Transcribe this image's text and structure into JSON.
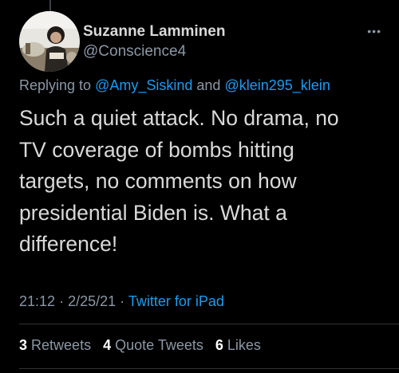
{
  "author": {
    "display_name": "Suzanne Lamminen",
    "handle": "@Conscience4"
  },
  "more_icon": "more-options-icon",
  "reply": {
    "prefix": "Replying to",
    "mention_1": "@Amy_Siskind",
    "connector": "and",
    "mention_2": "@klein295_klein"
  },
  "tweet": {
    "lines": [
      "Such a quiet attack. No drama, no",
      "TV coverage of bombs hitting",
      "targets, no comments on how",
      "presidential Biden is. What a",
      "difference!"
    ]
  },
  "meta": {
    "time": "21:12",
    "separator_1": "·",
    "date": "2/25/21",
    "separator_2": "·",
    "source": "Twitter for iPad"
  },
  "stats": {
    "retweets_count": "3",
    "retweets_label": "Retweets",
    "quotes_count": "4",
    "quotes_label": "Quote Tweets",
    "likes_count": "6",
    "likes_label": "Likes"
  },
  "colors": {
    "background": "#000000",
    "text": "#d9d9d9",
    "secondary": "#8b98a5",
    "accent": "#1d9bf0",
    "divider": "#2f3336"
  }
}
